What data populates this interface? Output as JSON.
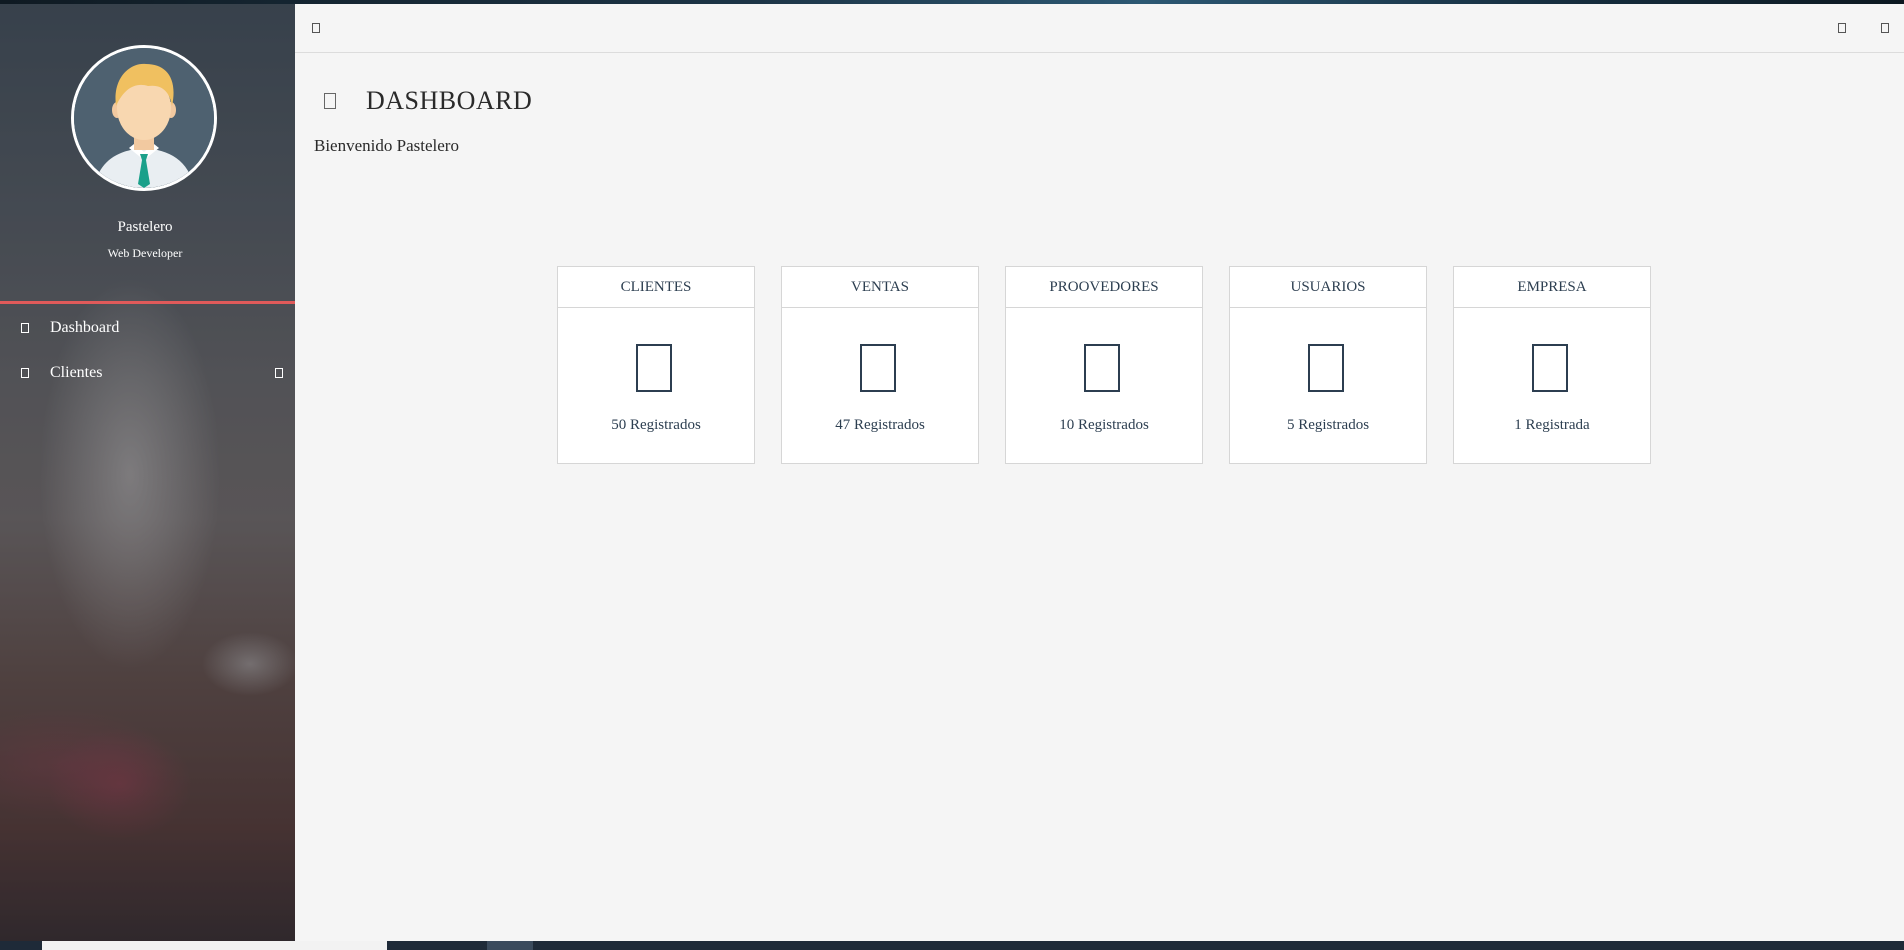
{
  "sidebar": {
    "profile": {
      "name": "Pastelero",
      "role": "Web Developer"
    },
    "items": [
      {
        "label": "Dashboard",
        "icon": "dashboard-icon"
      },
      {
        "label": "Clientes",
        "icon": "users-icon",
        "has_submenu": true
      }
    ],
    "accent_color": "#e05a5a"
  },
  "topbar": {
    "left_icon": "menu-toggle-icon",
    "right_icons": [
      "notifications-icon",
      "logout-icon"
    ]
  },
  "page": {
    "title": "DASHBOARD",
    "title_icon": "dashboard-icon",
    "welcome": "Bienvenido Pastelero"
  },
  "cards": [
    {
      "title": "CLIENTES",
      "count": "50 Registrados",
      "icon": "clients-icon"
    },
    {
      "title": "VENTAS",
      "count": "47 Registrados",
      "icon": "sales-icon"
    },
    {
      "title": "PROOVEDORES",
      "count": "10 Registrados",
      "icon": "suppliers-icon"
    },
    {
      "title": "USUARIOS",
      "count": "5 Registrados",
      "icon": "user-icon"
    },
    {
      "title": "EMPRESA",
      "count": "1 Registrada",
      "icon": "company-icon"
    }
  ],
  "colors": {
    "card_text": "#2c3e50",
    "main_bg": "#f5f5f5"
  }
}
